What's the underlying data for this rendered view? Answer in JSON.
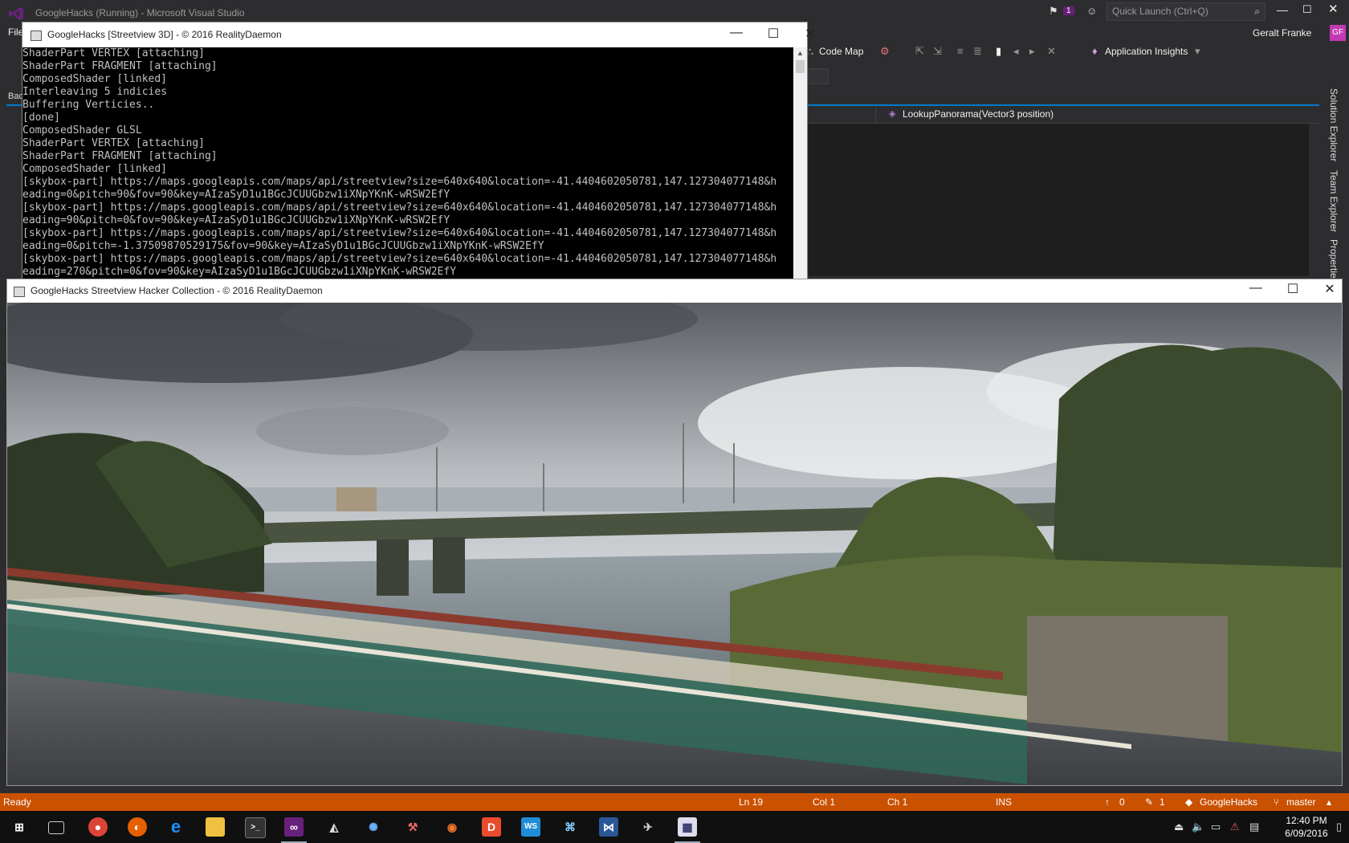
{
  "vs": {
    "title": "GoogleHacks (Running) - Microsoft Visual Studio",
    "notification_count": "1",
    "quick_launch_placeholder": "Quick Launch (Ctrl+Q)",
    "menu_file": "File",
    "user_name": "Geralt Franke",
    "avatar_initials": "GF",
    "toolbar": {
      "code_map": "Code Map",
      "app_insights": "Application Insights"
    },
    "back_label": "Bac",
    "nav_method": "LookupPanorama(Vector3 position)",
    "side_tabs": [
      "Solution Explorer",
      "Team Explorer",
      "Properties"
    ]
  },
  "console": {
    "title": "GoogleHacks [Streetview 3D] - © 2016 RealityDaemon",
    "lines": [
      "ShaderPart VERTEX [attaching]",
      "ShaderPart FRAGMENT [attaching]",
      "ComposedShader [linked]",
      "Interleaving 5 indicies",
      "Buffering Verticies..",
      "[done]",
      "ComposedShader GLSL",
      "ShaderPart VERTEX [attaching]",
      "ShaderPart FRAGMENT [attaching]",
      "ComposedShader [linked]",
      "[skybox-part] https://maps.googleapis.com/maps/api/streetview?size=640x640&location=-41.4404602050781,147.127304077148&h",
      "eading=0&pitch=90&fov=90&key=AIzaSyD1u1BGcJCUUGbzw1iXNpYKnK-wRSW2EfY",
      "[skybox-part] https://maps.googleapis.com/maps/api/streetview?size=640x640&location=-41.4404602050781,147.127304077148&h",
      "eading=90&pitch=0&fov=90&key=AIzaSyD1u1BGcJCUUGbzw1iXNpYKnK-wRSW2EfY",
      "[skybox-part] https://maps.googleapis.com/maps/api/streetview?size=640x640&location=-41.4404602050781,147.127304077148&h",
      "eading=0&pitch=-1.37509870529175&fov=90&key=AIzaSyD1u1BGcJCUUGbzw1iXNpYKnK-wRSW2EfY",
      "[skybox-part] https://maps.googleapis.com/maps/api/streetview?size=640x640&location=-41.4404602050781,147.127304077148&h",
      "eading=270&pitch=0&fov=90&key=AIzaSyD1u1BGcJCUUGbzw1iXNpYKnK-wRSW2EfY"
    ]
  },
  "streetview": {
    "title": "GoogleHacks Streetview Hacker Collection - © 2016 RealityDaemon"
  },
  "window_controls": {
    "minimize": "—",
    "maximize": "☐",
    "close": "✕"
  },
  "status": {
    "state": "Ready",
    "line": "Ln 19",
    "col": "Col 1",
    "ch": "Ch 1",
    "mode": "INS",
    "pushes": "0",
    "edits": "1",
    "repo": "GoogleHacks",
    "branch": "master"
  },
  "taskbar": {
    "time": "12:40 PM",
    "date": "6/09/2016",
    "apps": [
      "start",
      "task-view",
      "chrome",
      "firefox",
      "edge",
      "file-explorer",
      "terminal",
      "visual-studio",
      "unity",
      "app-light",
      "app-tool",
      "blender",
      "app-d",
      "webstorm",
      "app-network",
      "app-vs-code",
      "app-toolbox",
      "streetview-app"
    ]
  },
  "colors": {
    "vs_background": "#2d2d30",
    "status_bar": "#ca5100",
    "accent": "#007acc",
    "taskbar": "#101010"
  }
}
